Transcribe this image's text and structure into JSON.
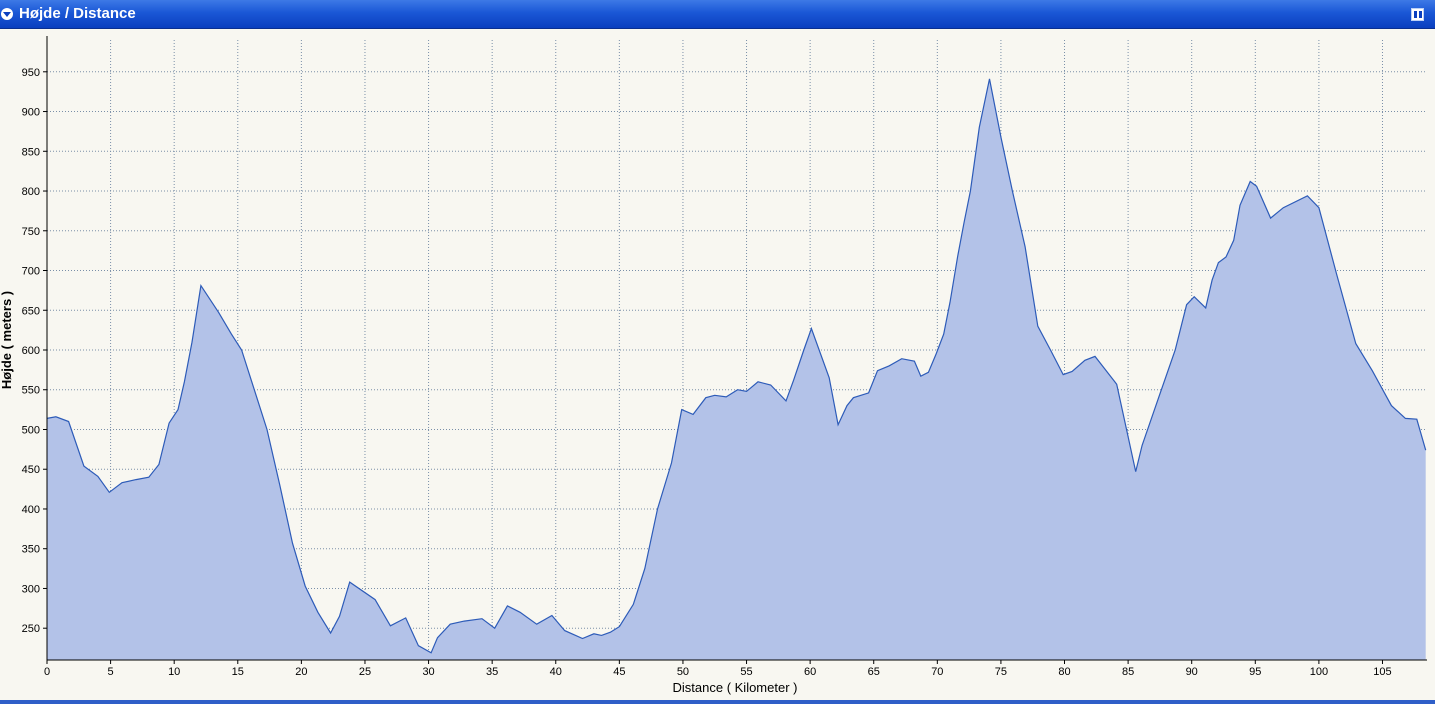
{
  "window": {
    "title": "Højde / Distance",
    "collapse_icon": "chevron-down-icon",
    "restore_icon": "restore-window-icon"
  },
  "colors": {
    "title_bar": "#1a57d6",
    "plot_background": "#f8f7f1",
    "area_fill": "#b3c2e8",
    "area_line": "#2d5bb8",
    "grid": "#7a8fa8"
  },
  "chart_data": {
    "type": "area",
    "title": "",
    "xlabel": "Distance ( Kilometer )",
    "ylabel": "Højde ( meters )",
    "xlim": [
      0,
      108.5
    ],
    "ylim": [
      210,
      990
    ],
    "xticks": [
      0,
      5,
      10,
      15,
      20,
      25,
      30,
      35,
      40,
      45,
      50,
      55,
      60,
      65,
      70,
      75,
      80,
      85,
      90,
      95,
      100,
      105
    ],
    "yticks": [
      250,
      300,
      350,
      400,
      450,
      500,
      550,
      600,
      650,
      700,
      750,
      800,
      850,
      900,
      950
    ],
    "grid": true,
    "series": [
      {
        "x": [
          0,
          0.7,
          1.7,
          2.9,
          4,
          4.9,
          5.9,
          7,
          8,
          8.8,
          9.6,
          10.3,
          10.8,
          11.4,
          12.1,
          13.5,
          14.5,
          15.3,
          16.3,
          17.3,
          18.3,
          19.3,
          20.3,
          21.3,
          22.3,
          23,
          23.8,
          25.8,
          27,
          28.2,
          29.2,
          30.2,
          30.7,
          31.7,
          32.8,
          34.2,
          35.2,
          36.2,
          37.2,
          38.5,
          39.7,
          40.7,
          42.1,
          43,
          43.6,
          44.3,
          45,
          46.1,
          47,
          48,
          49.1,
          49.9,
          50.8,
          51.8,
          52.5,
          53.4,
          54.3,
          55,
          55.3,
          55.9,
          56.9,
          58.1,
          58.7,
          59.5,
          60.1,
          61.5,
          62.2,
          62.9,
          63.4,
          64.6,
          65.3,
          66.2,
          67.2,
          68.2,
          68.7,
          69.3,
          69.9,
          70.5,
          71,
          71.6,
          72.1,
          72.6,
          73.3,
          74.1,
          75,
          75.9,
          76.9,
          77.9,
          78.9,
          79.9,
          80.6,
          81.6,
          82.4,
          84.1,
          85.6,
          86.1,
          87.4,
          88.7,
          89.6,
          90.2,
          91.1,
          91.6,
          92.1,
          92.7,
          93.3,
          93.8,
          94.6,
          95.1,
          96.2,
          97.2,
          99.1,
          100,
          101.4,
          102.9,
          104.2,
          105.7,
          106.8,
          107.7,
          108.4
        ],
        "y": [
          514,
          516,
          510,
          454,
          441,
          421,
          433,
          437,
          440,
          456,
          508,
          525,
          560,
          610,
          681,
          647,
          620,
          600,
          550,
          500,
          430,
          357,
          303,
          270,
          244,
          265,
          308,
          286,
          253,
          263,
          228,
          219,
          238,
          255,
          259,
          262,
          250,
          278,
          270,
          255,
          266,
          247,
          237,
          243,
          241,
          245,
          252,
          280,
          325,
          400,
          458,
          525,
          519,
          540,
          543,
          541,
          550,
          548,
          552,
          560,
          556,
          536,
          562,
          600,
          627,
          565,
          506,
          530,
          540,
          546,
          574,
          580,
          589,
          586,
          567,
          572,
          595,
          620,
          660,
          718,
          760,
          800,
          880,
          941,
          868,
          800,
          730,
          630,
          600,
          569,
          573,
          587,
          592,
          557,
          447,
          480,
          540,
          600,
          657,
          667,
          653,
          688,
          710,
          717,
          738,
          782,
          812,
          806,
          766,
          779,
          794,
          779,
          695,
          608,
          574,
          530,
          514,
          513,
          474
        ]
      }
    ]
  }
}
